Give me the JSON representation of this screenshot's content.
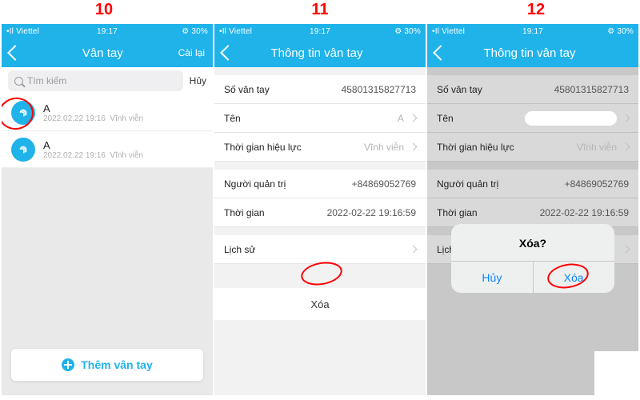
{
  "step_labels": {
    "s10": "10",
    "s11": "11",
    "s12": "12"
  },
  "statusbar": {
    "carrier_indicator": "•Il Viettel",
    "signal_icon": "wifi",
    "time": "19:17",
    "battery_text": "⚙ 30%",
    "battery_icon": "battery"
  },
  "screen1": {
    "title": "Vân tay",
    "header_right": "Cài lại",
    "search_placeholder": "Tìm kiếm",
    "search_cancel": "Hủy",
    "add_button": "Thêm vân tay",
    "items": [
      {
        "name": "A",
        "date": "2022.02.22 19:16",
        "status": "Vĩnh viễn"
      },
      {
        "name": "A",
        "date": "2022.02.22 19:16",
        "status": "Vĩnh viễn"
      }
    ]
  },
  "screen2": {
    "title": "Thông tin vân tay",
    "rows": {
      "so_van_tay": {
        "label": "Số vân tay",
        "value": "45801315827713"
      },
      "ten": {
        "label": "Tên",
        "value": "A"
      },
      "thoi_gian_hl": {
        "label": "Thời gian hiệu lực",
        "value": "Vĩnh viễn"
      },
      "nguoi_qt": {
        "label": "Người quản trị",
        "value": "+84869052769"
      },
      "thoi_gian": {
        "label": "Thời gian",
        "value": "2022-02-22 19:16:59"
      },
      "lich_su": {
        "label": "Lịch sử"
      }
    },
    "delete": "Xóa"
  },
  "screen3": {
    "title": "Thông tin vân tay",
    "rows": {
      "so_van_tay": {
        "label": "Số vân tay",
        "value": "45801315827713"
      },
      "ten": {
        "label": "Tên",
        "value": ""
      },
      "thoi_gian_hl": {
        "label": "Thời gian hiệu lực",
        "value": "Vĩnh viễn"
      },
      "nguoi_qt": {
        "label": "Người quản trị",
        "value": "+84869052769"
      },
      "thoi_gian": {
        "label": "Thời gian",
        "value": "2022-02-22 19:16:59"
      },
      "lich_su": {
        "label": "Lịch sử"
      }
    },
    "dialog": {
      "title": "Xóa?",
      "cancel": "Hủy",
      "confirm": "Xóa"
    }
  }
}
